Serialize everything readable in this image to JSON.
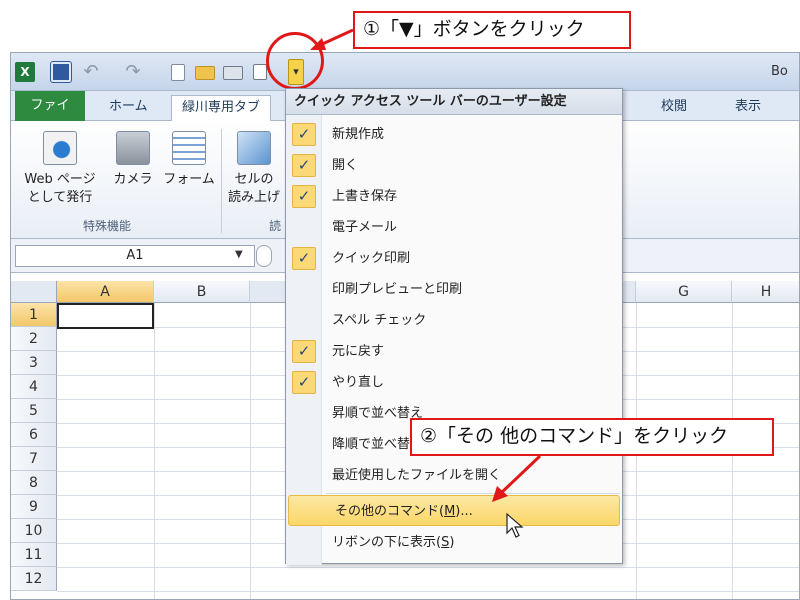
{
  "window": {
    "title_text": "Bo"
  },
  "qat": {
    "excel_logo": "X",
    "dropdown_glyph": "▾"
  },
  "tabs": {
    "file": "ファイル",
    "home": "ホーム",
    "custom": "緑川専用タブ",
    "review": "校閲",
    "view": "表示"
  },
  "ribbon": {
    "web_page_line1": "Web ページ",
    "web_page_line2": "として発行",
    "camera": "カメラ",
    "form": "フォーム",
    "speak_line1": "セルの",
    "speak_line2": "読み上げ",
    "group_special": "特殊機能",
    "group_read": "読"
  },
  "formula_bar": {
    "name_box": "A1"
  },
  "grid": {
    "columns": [
      "A",
      "B",
      "G",
      "H"
    ],
    "rows": [
      "1",
      "2",
      "3",
      "4",
      "5",
      "6",
      "7",
      "8",
      "9",
      "10",
      "11",
      "12"
    ]
  },
  "menu": {
    "header": "クイック アクセス ツール バーのユーザー設定",
    "items": [
      {
        "label": "新規作成",
        "checked": true
      },
      {
        "label": "開く",
        "checked": true
      },
      {
        "label": "上書き保存",
        "checked": true
      },
      {
        "label": "電子メール",
        "checked": false
      },
      {
        "label": "クイック印刷",
        "checked": true
      },
      {
        "label": "印刷プレビューと印刷",
        "checked": false
      },
      {
        "label": "スペル チェック",
        "checked": false
      },
      {
        "label": "元に戻す",
        "checked": true
      },
      {
        "label": "やり直し",
        "checked": true
      },
      {
        "label": "昇順で並べ替え",
        "checked": false
      },
      {
        "label": "降順で並べ替え",
        "checked": false
      },
      {
        "label": "最近使用したファイルを開く",
        "checked": false
      }
    ],
    "more_commands_prefix": "その他のコマンド(",
    "more_commands_key": "M",
    "more_commands_suffix": ")...",
    "below_ribbon_prefix": "リボンの下に表示(",
    "below_ribbon_key": "S",
    "below_ribbon_suffix": ")",
    "check_glyph": "✓"
  },
  "callouts": {
    "step1": "①「▼」ボタンをクリック",
    "step2": "②「その 他のコマンド」をクリック"
  },
  "colors": {
    "callout_border": "#e01818",
    "menu_highlight": "#fbd769",
    "file_tab": "#2d8a3e"
  }
}
